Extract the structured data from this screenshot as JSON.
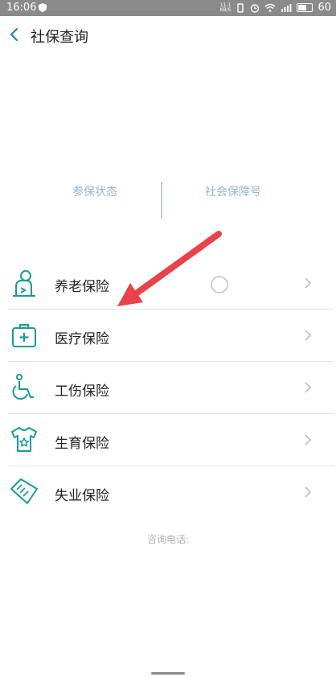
{
  "status_bar": {
    "time": "16:06",
    "net_speed_top": "11.1",
    "net_speed_bottom": "KB/S",
    "battery": "60"
  },
  "header": {
    "title": "社保查询"
  },
  "tabs": {
    "left": "参保状态",
    "right": "社会保障号"
  },
  "list": [
    {
      "label": "养老保险",
      "icon": "elder-person-icon"
    },
    {
      "label": "医疗保险",
      "icon": "medical-kit-icon"
    },
    {
      "label": "工伤保险",
      "icon": "wheelchair-icon"
    },
    {
      "label": "生育保险",
      "icon": "baby-clothes-icon"
    },
    {
      "label": "失业保险",
      "icon": "unemployment-card-icon"
    }
  ],
  "consult_label": "咨询电话:",
  "colors": {
    "accent": "#1a9c95",
    "arrow": "#e8424a"
  }
}
